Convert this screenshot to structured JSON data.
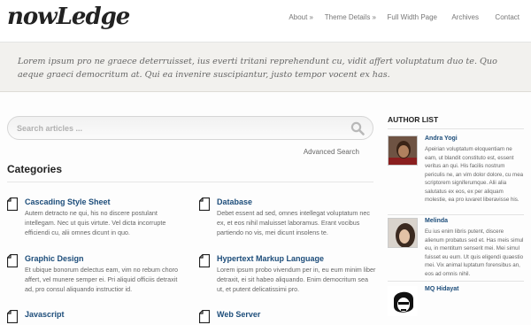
{
  "header": {
    "logo": "nowLedge",
    "nav": [
      {
        "label": "About »"
      },
      {
        "label": "Theme Details »"
      },
      {
        "label": "Full Width Page"
      },
      {
        "label": "Archives"
      },
      {
        "label": "Contact"
      }
    ]
  },
  "intro": {
    "text": "Lorem ipsum pro ne graece deterruisset, ius everti tritani reprehendunt cu, vidit affert voluptatum duo te. Quo aeque graeci democritum at. Qui ea invenire suscipiantur, justo tempor vocent ex has."
  },
  "search": {
    "placeholder": "Search articles ...",
    "advanced_label": "Advanced Search"
  },
  "categories": {
    "heading": "Categories",
    "items": [
      {
        "title": "Cascading Style Sheet",
        "desc": "Autem detracto ne qui, his no discere postulant intellegam. Nec ut quis virtute. Vel dicta incorrupte efficiendi cu, alii omnes dicunt in quo."
      },
      {
        "title": "Database",
        "desc": "Debet essent ad sed, omnes intellegat voluptatum nec ex, et eos nihil maluisset laboramus. Erant vocibus partiendo no vis, mei dicunt insolens te."
      },
      {
        "title": "Graphic Design",
        "desc": "Et ubique bonorum delectus eam, vim no rebum choro affert, vel munere semper ei. Pri aliquid officiis detraxit ad, pro consul aliquando instructior id."
      },
      {
        "title": "Hypertext Markup Language",
        "desc": "Lorem ipsum probo vivendum per in, eu eum minim liber detraxit, ei sit habeo aliquando. Enim democritum sea ut, et putent delicatissimi pro."
      },
      {
        "title": "Javascript",
        "desc": ""
      },
      {
        "title": "Web Server",
        "desc": ""
      }
    ]
  },
  "sidebar": {
    "heading": "AUTHOR LIST",
    "authors": [
      {
        "name": "Andra Yogi",
        "bio": "Apeirian voluptatum eloquentiam ne eam, ut blandit constituto est, essent veritus an qui. His facilis nostrum periculis ne, an vim dolor dolore, cu mea scriptorem signiferumque. Alii alia salutatus ex eos, ex per aliquam molestie, ea pro iuvaret liberavisse his."
      },
      {
        "name": "Melinda",
        "bio": "Eu ius enim libris putent, discere alienum probatus sed et. Has meis simul eu, in mentitum senserit mei. Mei simul fuisset eu eum. Ut quis eligendi quaestio mei. Vix animal luptatum forensibus an, eos ad omnis nihil."
      },
      {
        "name": "MQ Hidayat",
        "bio": ""
      }
    ]
  }
}
